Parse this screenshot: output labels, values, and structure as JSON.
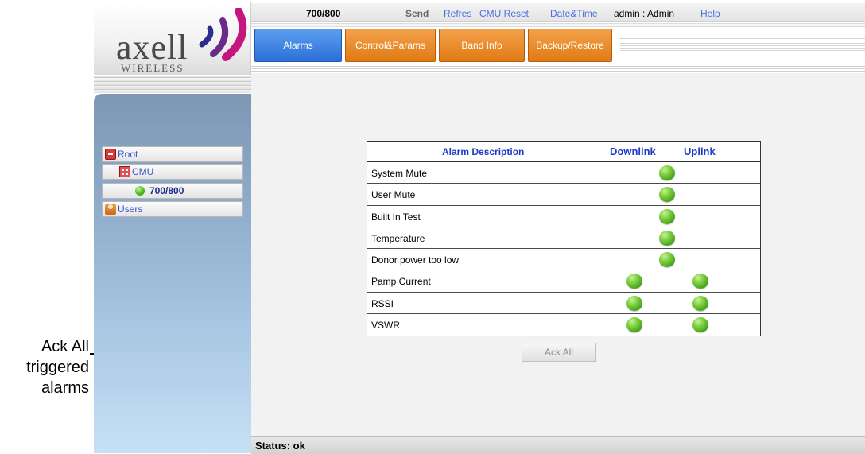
{
  "callout": {
    "line1": "Ack All",
    "line2": "triggered",
    "line3": "alarms"
  },
  "logo": {
    "name": "axell",
    "sub": "WIRELESS"
  },
  "topbar": {
    "title": "700/800",
    "send": "Send",
    "refresh": "Refres",
    "cmu_reset": "CMU Reset",
    "date_time": "Date&Time",
    "user": "admin : Admin",
    "help": "Help"
  },
  "tabs": [
    {
      "label": "Alarms",
      "color": "#2c6fd6"
    },
    {
      "label": "Control&Params",
      "color": "#e07b14"
    },
    {
      "label": "Band Info",
      "color": "#e07b14"
    },
    {
      "label": "Backup/Restore",
      "color": "#e07b14"
    }
  ],
  "tree": {
    "root": "Root",
    "cmu": "CMU",
    "band": "700/800",
    "users": "Users"
  },
  "alarm_table": {
    "headers": {
      "description": "Alarm Description",
      "downlink": "Downlink",
      "uplink": "Uplink"
    },
    "rows": [
      {
        "description": "System Mute",
        "status": "ok",
        "indicator": "single"
      },
      {
        "description": "User Mute",
        "status": "ok",
        "indicator": "single"
      },
      {
        "description": "Built In Test",
        "status": "ok",
        "indicator": "single"
      },
      {
        "description": "Temperature",
        "status": "ok",
        "indicator": "single"
      },
      {
        "description": "Donor power too low",
        "status": "ok",
        "indicator": "single"
      },
      {
        "description": "Pamp Current",
        "downlink": "ok",
        "uplink": "ok"
      },
      {
        "description": "RSSI",
        "downlink": "ok",
        "uplink": "ok"
      },
      {
        "description": "VSWR",
        "downlink": "ok",
        "uplink": "ok"
      }
    ],
    "ok_color": "#5cc62a"
  },
  "ack_all_label": "Ack All",
  "status": "Status: ok"
}
